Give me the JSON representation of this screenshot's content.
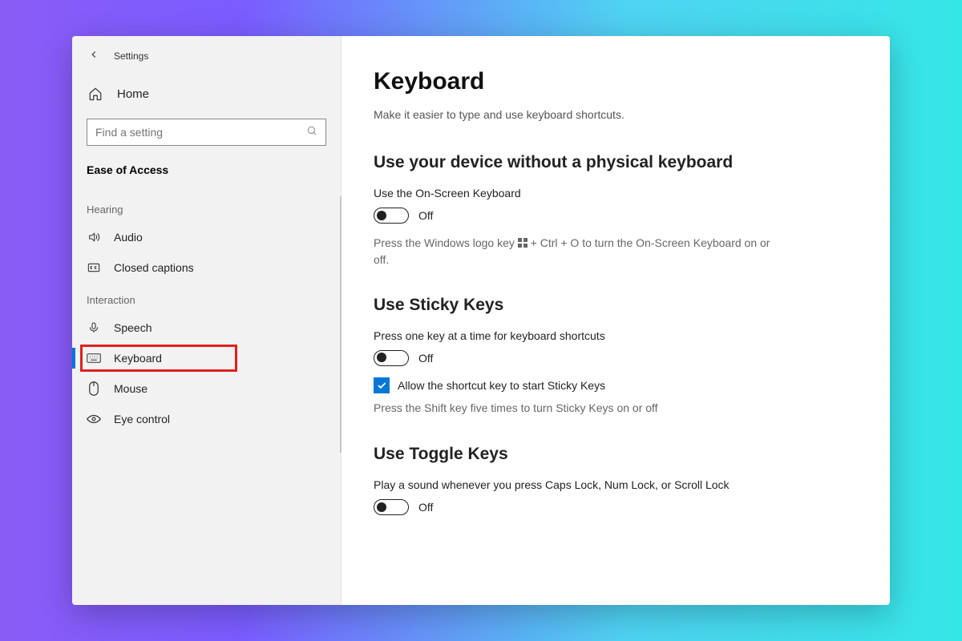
{
  "titlebar": {
    "label": "Settings"
  },
  "home": {
    "label": "Home"
  },
  "search": {
    "placeholder": "Find a setting"
  },
  "category": "Ease of Access",
  "groups": {
    "hearing": {
      "label": "Hearing",
      "items": [
        {
          "label": "Audio"
        },
        {
          "label": "Closed captions"
        }
      ]
    },
    "interaction": {
      "label": "Interaction",
      "items": [
        {
          "label": "Speech"
        },
        {
          "label": "Keyboard"
        },
        {
          "label": "Mouse"
        },
        {
          "label": "Eye control"
        }
      ]
    }
  },
  "page": {
    "title": "Keyboard",
    "subtitle": "Make it easier to type and use keyboard shortcuts.",
    "section1": {
      "heading": "Use your device without a physical keyboard",
      "setting": "Use the On-Screen Keyboard",
      "toggle_state": "Off",
      "hint_pre": "Press the Windows logo key ",
      "hint_post": " + Ctrl + O to turn the On-Screen Keyboard on or off."
    },
    "section2": {
      "heading": "Use Sticky Keys",
      "setting": "Press one key at a time for keyboard shortcuts",
      "toggle_state": "Off",
      "checkbox_label": "Allow the shortcut key to start Sticky Keys",
      "hint": "Press the Shift key five times to turn Sticky Keys on or off"
    },
    "section3": {
      "heading": "Use Toggle Keys",
      "setting": "Play a sound whenever you press Caps Lock, Num Lock, or Scroll Lock",
      "toggle_state": "Off"
    }
  }
}
